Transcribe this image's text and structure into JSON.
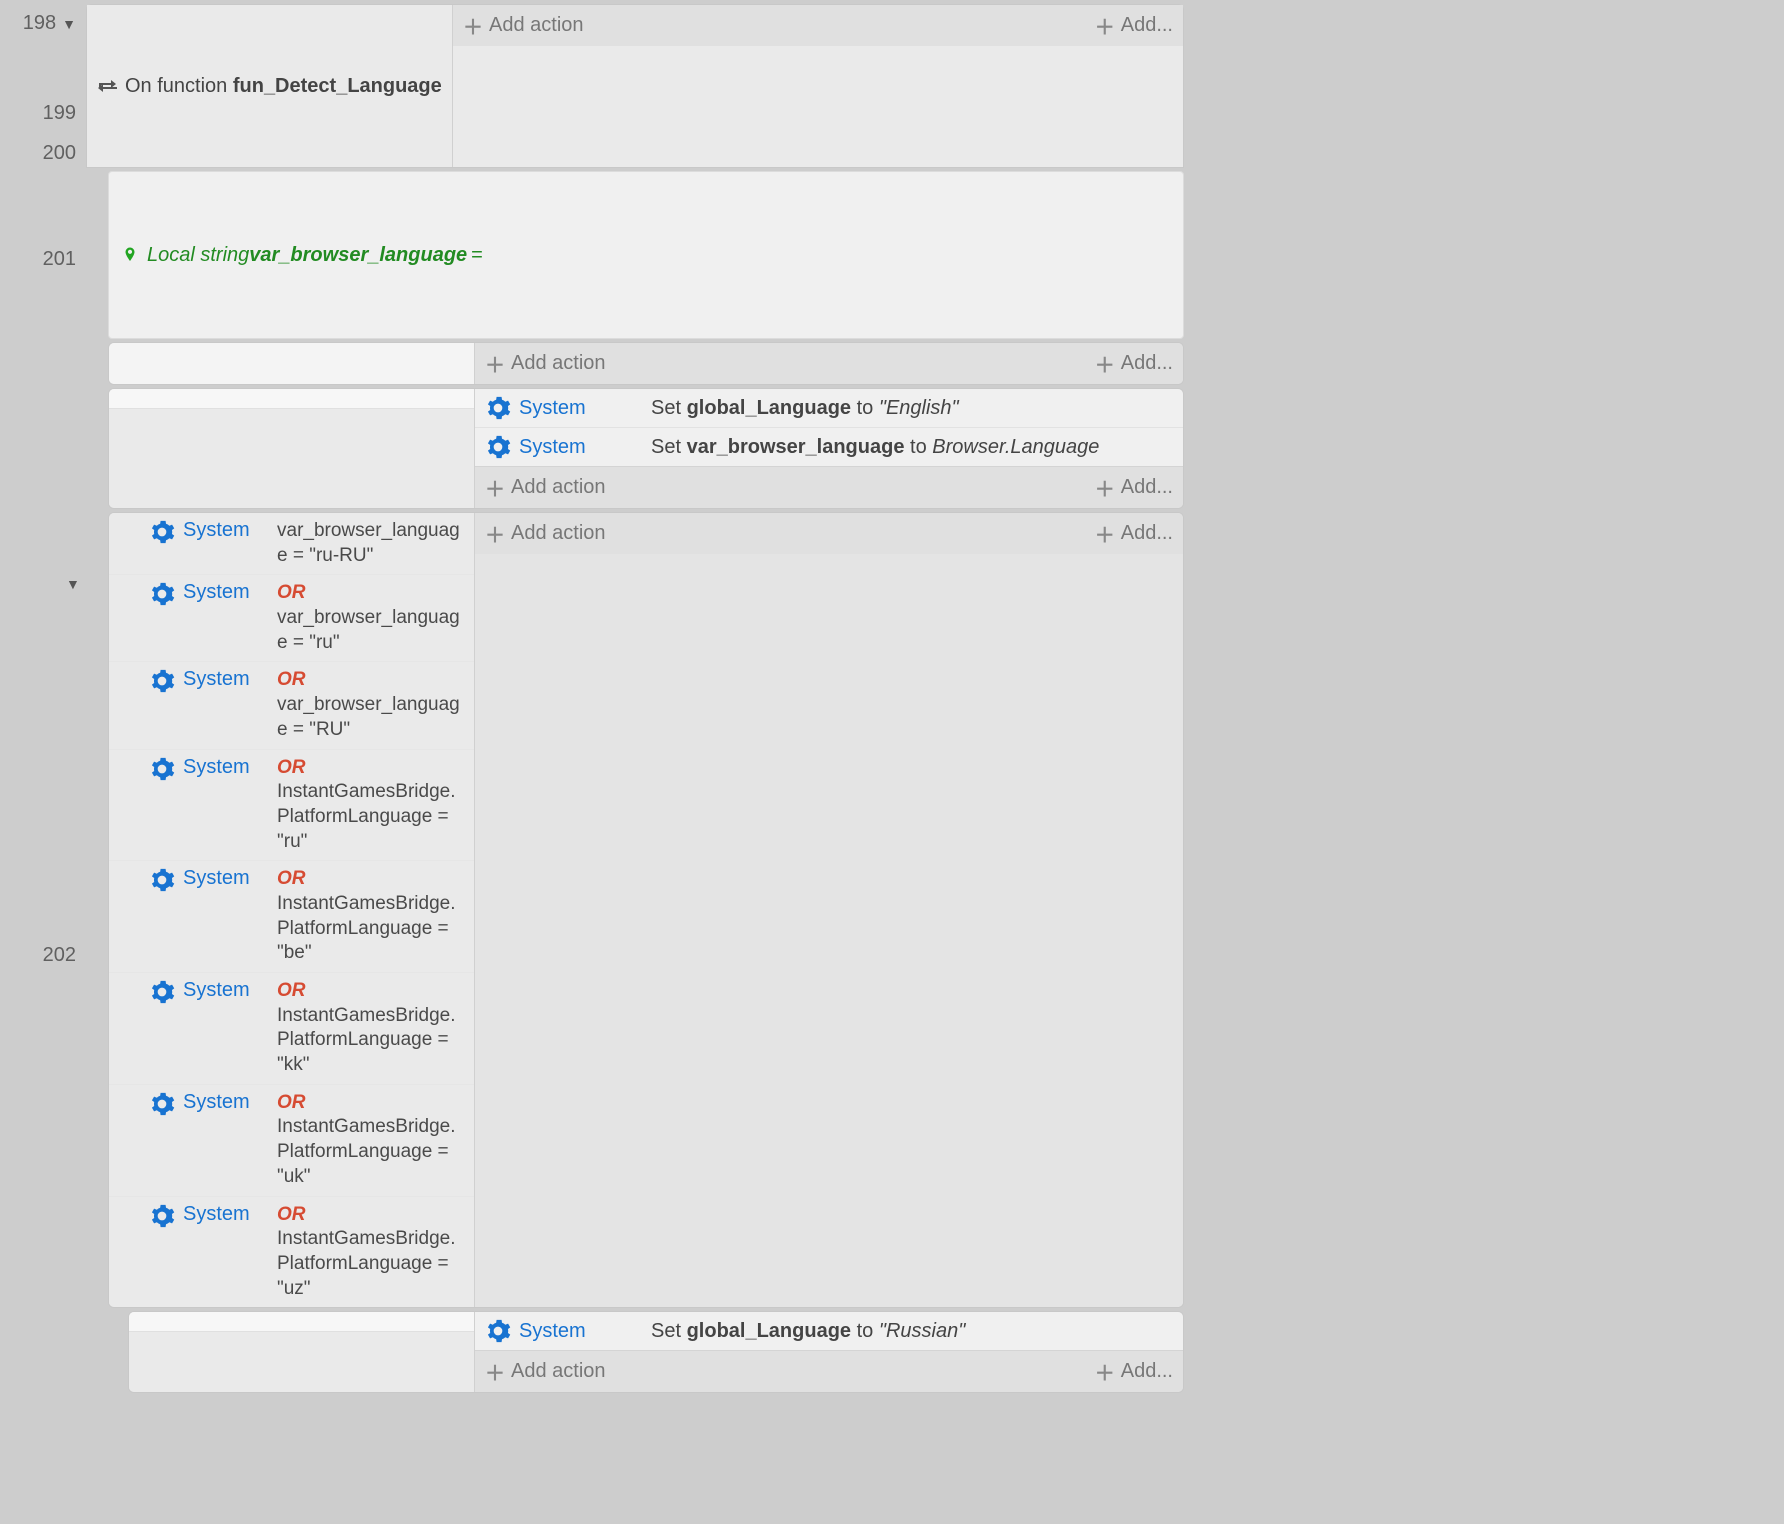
{
  "labels": {
    "add_action": "Add action",
    "add": "Add...",
    "system": "System",
    "or": "OR"
  },
  "lines": {
    "n198": "198",
    "n199": "199",
    "n200": "200",
    "n201": "201",
    "n202": "202"
  },
  "row198": {
    "prefix": "On function ",
    "fn_name": "fun_Detect_Language"
  },
  "localvar": {
    "type_label": "Local string ",
    "name": "var_browser_language",
    "suffix": " ="
  },
  "row200": {
    "actions": [
      {
        "pre": "Set ",
        "bold": "global_Language",
        "mid": " to ",
        "ital": "\"English\""
      },
      {
        "pre": "Set ",
        "bold": "var_browser_language",
        "mid": " to ",
        "ital": "Browser.Language"
      }
    ]
  },
  "row201": {
    "conditions": [
      {
        "or": false,
        "text": "var_browser_language = \"ru-RU\""
      },
      {
        "or": true,
        "text": "var_browser_language = \"ru\""
      },
      {
        "or": true,
        "text": "var_browser_language = \"RU\""
      },
      {
        "or": true,
        "text": "InstantGamesBridge.PlatformLanguage = \"ru\""
      },
      {
        "or": true,
        "text": "InstantGamesBridge.PlatformLanguage = \"be\""
      },
      {
        "or": true,
        "text": "InstantGamesBridge.PlatformLanguage = \"kk\""
      },
      {
        "or": true,
        "text": "InstantGamesBridge.PlatformLanguage = \"uk\""
      },
      {
        "or": true,
        "text": "InstantGamesBridge.PlatformLanguage = \"uz\""
      }
    ]
  },
  "row202": {
    "action": {
      "pre": "Set ",
      "bold": "global_Language",
      "mid": " to ",
      "ital": "\"Russian\""
    }
  }
}
